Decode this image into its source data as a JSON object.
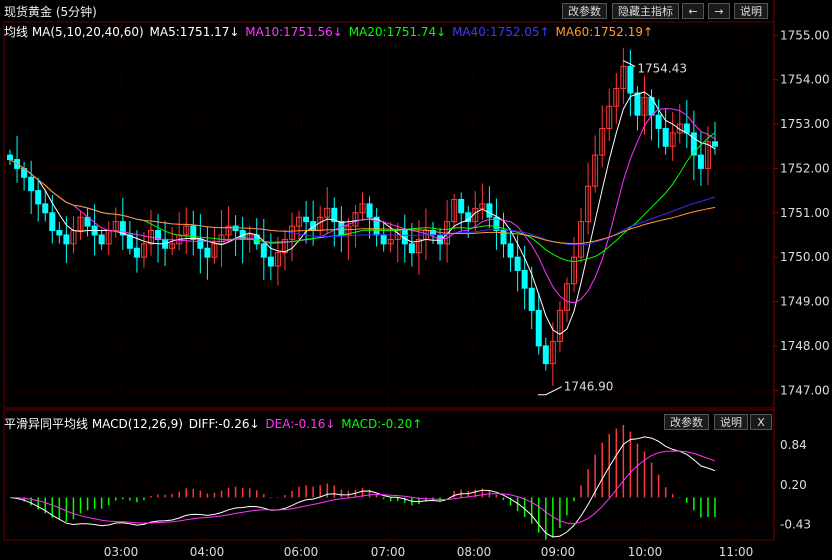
{
  "header": {
    "title": "现货黄金 (5分钟)",
    "buttons": [
      "改参数",
      "隐藏主指标",
      "←",
      "→",
      "说明"
    ]
  },
  "main_legend": {
    "name": "均线 MA(5,10,20,40,60)",
    "ma5": "MA5:1751.17↓",
    "ma10": "MA10:1751.56↓",
    "ma20": "MA20:1751.74↓",
    "ma40": "MA40:1752.05↑",
    "ma60": "MA60:1752.19↑"
  },
  "macd_legend": {
    "name": "平滑异同平均线 MACD(12,26,9)",
    "diff": "DIFF:-0.26↓",
    "dea": "DEA:-0.16↓",
    "macd": "MACD:-0.20↑",
    "buttons": [
      "改参数",
      "说明",
      "X"
    ]
  },
  "colors": {
    "up": "#ff3a3a",
    "down": "#00ffff",
    "ma5": "#ffffff",
    "ma10": "#ff33ff",
    "ma20": "#00ff00",
    "ma40": "#3030ff",
    "ma60": "#ff9933",
    "grid": "#3a0000"
  },
  "chart_data": [
    {
      "type": "candlestick",
      "title": "现货黄金 (5分钟)",
      "ylim": [
        1746.6,
        1755.3
      ],
      "y_ticks": [
        "1755.00",
        "1754.00",
        "1753.00",
        "1752.00",
        "1751.00",
        "1750.00",
        "1749.00",
        "1748.00",
        "1747.00"
      ],
      "annotations": [
        {
          "label": "1754.43",
          "value": 1754.43
        },
        {
          "label": "1746.90",
          "value": 1746.9
        }
      ],
      "closes": [
        1752.2,
        1752.0,
        1751.8,
        1751.5,
        1751.2,
        1751.0,
        1750.6,
        1750.5,
        1750.3,
        1750.6,
        1750.9,
        1750.7,
        1750.5,
        1750.3,
        1750.6,
        1750.8,
        1750.5,
        1750.2,
        1750.0,
        1750.3,
        1750.6,
        1750.4,
        1750.2,
        1750.3,
        1750.5,
        1750.7,
        1750.4,
        1750.2,
        1750.0,
        1750.3,
        1750.5,
        1750.7,
        1750.6,
        1750.4,
        1750.5,
        1750.3,
        1750.0,
        1749.8,
        1750.1,
        1750.4,
        1750.7,
        1750.9,
        1750.8,
        1750.6,
        1750.9,
        1751.1,
        1750.8,
        1750.5,
        1750.7,
        1751.0,
        1751.2,
        1750.9,
        1750.5,
        1750.3,
        1750.4,
        1750.6,
        1750.3,
        1750.1,
        1750.4,
        1750.6,
        1750.5,
        1750.3,
        1750.8,
        1751.3,
        1751.0,
        1750.8,
        1751.1,
        1751.2,
        1750.9,
        1750.6,
        1750.3,
        1750.0,
        1749.7,
        1749.3,
        1748.8,
        1748.0,
        1747.6,
        1748.1,
        1748.8,
        1749.4,
        1750.0,
        1750.8,
        1751.6,
        1752.3,
        1752.9,
        1753.4,
        1753.8,
        1754.3,
        1753.7,
        1753.2,
        1753.6,
        1753.2,
        1752.9,
        1752.5,
        1752.8,
        1753.0,
        1752.8,
        1752.3,
        1752.0,
        1752.6,
        1752.5
      ],
      "x_ticks": [
        "03:00",
        "04:00",
        "06:00",
        "07:00",
        "08:00",
        "09:00",
        "10:00",
        "11:00"
      ],
      "series": [
        {
          "name": "MA5"
        },
        {
          "name": "MA10"
        },
        {
          "name": "MA20"
        },
        {
          "name": "MA40"
        },
        {
          "name": "MA60"
        }
      ]
    },
    {
      "type": "bar",
      "title": "平滑异同平均线 MACD(12,26,9)",
      "ylim": [
        -0.65,
        1.05
      ],
      "y_ticks": [
        "0.84",
        "0.20",
        "-0.43"
      ],
      "series": [
        {
          "name": "DIFF"
        },
        {
          "name": "DEA"
        },
        {
          "name": "MACD"
        }
      ]
    }
  ]
}
